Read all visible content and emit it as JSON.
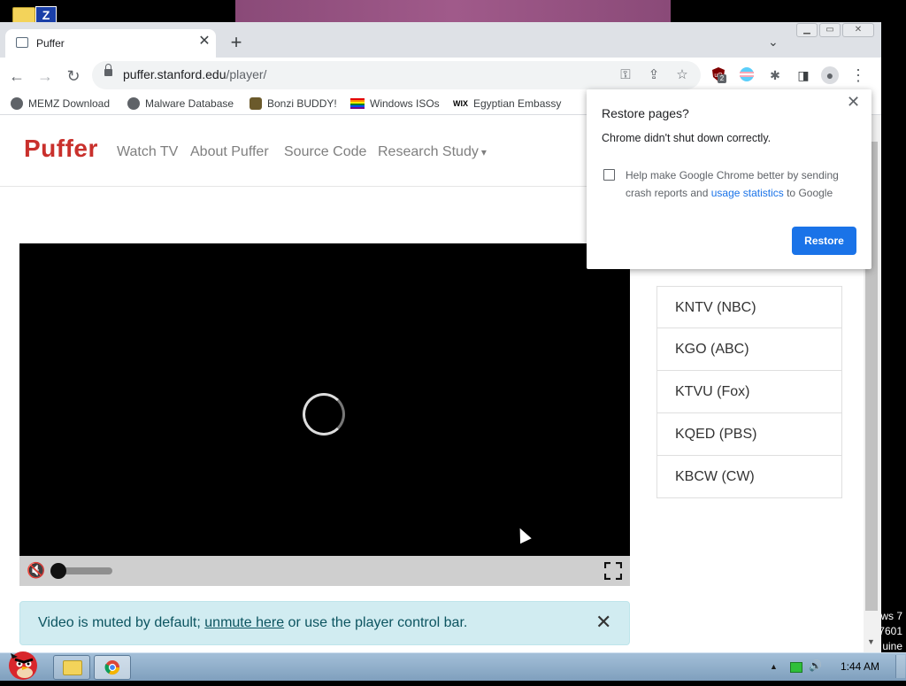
{
  "desktop": {
    "z_icon_glyph": "Z",
    "watermark_lines": [
      "ws 7",
      "7601",
      "uine"
    ]
  },
  "browser": {
    "tab": {
      "title": "Puffer",
      "close_glyph": "✕"
    },
    "new_tab_glyph": "+",
    "tab_search_glyph": "⌄",
    "window_controls": {
      "minimize": "▁",
      "maximize": "▭",
      "close": "✕"
    },
    "nav": {
      "back": "←",
      "forward": "→",
      "reload": "↻"
    },
    "url": {
      "host": "puffer.stanford.edu",
      "path": "/player/"
    },
    "omnibox_icons": {
      "key": "⚿",
      "share": "⇪",
      "star": "☆"
    },
    "extensions": {
      "ublock_badge": "2",
      "puzzle": "✱",
      "sidepanel": "◨",
      "profile": "●",
      "menu": "⋮"
    },
    "bookmarks": [
      {
        "label": "MEMZ Download",
        "icon": "globe-icon"
      },
      {
        "label": "Malware Database",
        "icon": "globe-icon"
      },
      {
        "label": "Bonzi BUDDY!",
        "icon": "bonzi-icon"
      },
      {
        "label": "Windows ISOs",
        "icon": "rainbow-flag-icon"
      },
      {
        "label": "Egyptian Embassy",
        "icon": "wix-icon"
      }
    ],
    "wix_glyph": "WIX"
  },
  "page": {
    "brand": "Puffer",
    "nav_links": [
      "Watch TV",
      "About Puffer",
      "Source Code",
      "Research Study"
    ],
    "research_caret": "▾",
    "player": {
      "mute_glyph": "🔇",
      "seek_level": 0
    },
    "alert": {
      "prefix": "Video is muted by default; ",
      "link": "unmute here",
      "suffix": " or use the player control bar.",
      "close_glyph": "✕"
    },
    "channels": [
      "KNTV (NBC)",
      "KGO (ABC)",
      "KTVU (Fox)",
      "KQED (PBS)",
      "KBCW (CW)"
    ]
  },
  "restore_dialog": {
    "title": "Restore pages?",
    "message": "Chrome didn't shut down correctly.",
    "help_prefix": "Help make Google Chrome better by sending crash reports and ",
    "help_link": "usage statistics",
    "help_suffix": " to Google",
    "checked": false,
    "restore_label": "Restore",
    "close_glyph": "✕"
  },
  "taskbar": {
    "clock": "1:44 AM",
    "tray_up": "▲",
    "tray_volume": "🔊"
  },
  "colors": {
    "brand_red": "#c9302c",
    "chrome_blue": "#1a73e8",
    "alert_bg": "#d1ecf1",
    "alert_text": "#0c5460"
  }
}
